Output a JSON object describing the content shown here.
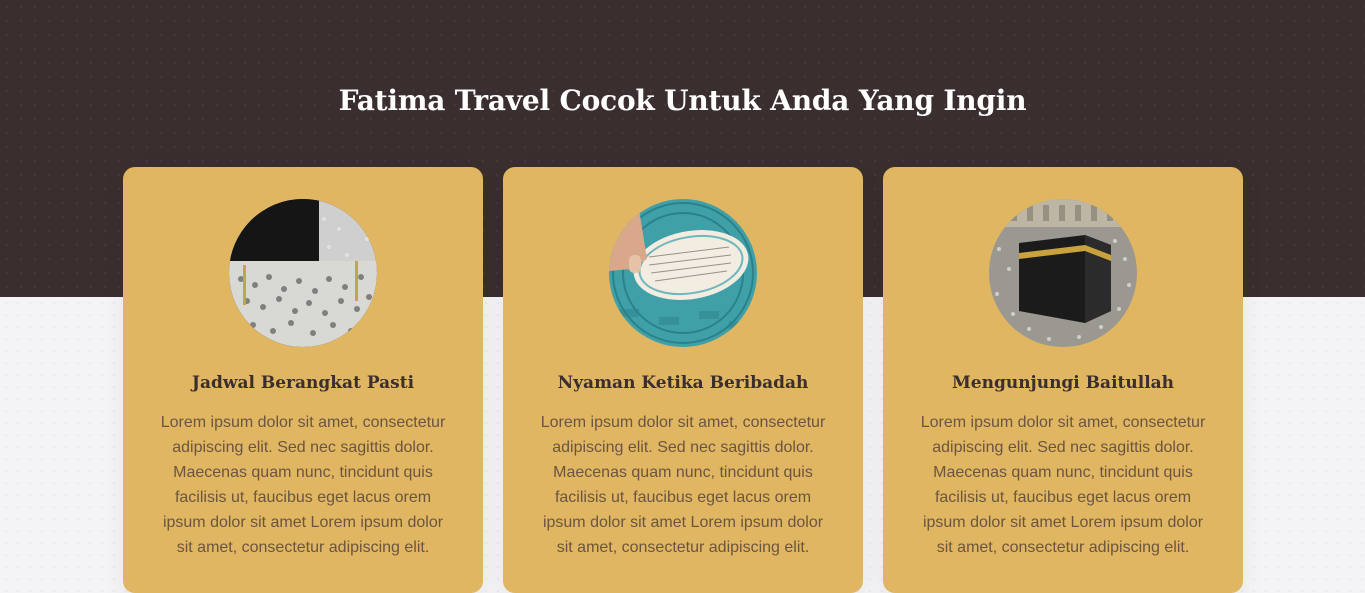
{
  "section": {
    "heading": "Fatima Travel Cocok Untuk Anda Yang Ingin"
  },
  "cards": [
    {
      "title": "Jadwal Berangkat Pasti",
      "image_icon": "kaaba-crowd-photo",
      "text": "Lorem ipsum dolor sit amet, consectetur adipiscing elit. Sed nec sagittis dolor. Maecenas quam nunc, tincidunt quis facilisis ut, faucibus eget lacus orem ipsum dolor sit amet Lorem ipsum dolor sit amet, consectetur adipiscing elit."
    },
    {
      "title": "Nyaman Ketika Beribadah",
      "image_icon": "quran-reading-photo",
      "text": "Lorem ipsum dolor sit amet, consectetur adipiscing elit. Sed nec sagittis dolor. Maecenas quam nunc, tincidunt quis facilisis ut, faucibus eget lacus orem ipsum dolor sit amet Lorem ipsum dolor sit amet, consectetur adipiscing elit."
    },
    {
      "title": "Mengunjungi Baitullah",
      "image_icon": "kaaba-photo",
      "text": "Lorem ipsum dolor sit amet, consectetur adipiscing elit. Sed nec sagittis dolor. Maecenas quam nunc, tincidunt quis facilisis ut, faucibus eget lacus orem ipsum dolor sit amet Lorem ipsum dolor sit amet, consectetur adipiscing elit."
    }
  ],
  "colors": {
    "dark_band": "#3a2e2e",
    "card_background": "#e0b662",
    "heading_text": "#ffffff",
    "card_title_text": "#3a2e2e",
    "card_body_text": "#6a5540"
  }
}
